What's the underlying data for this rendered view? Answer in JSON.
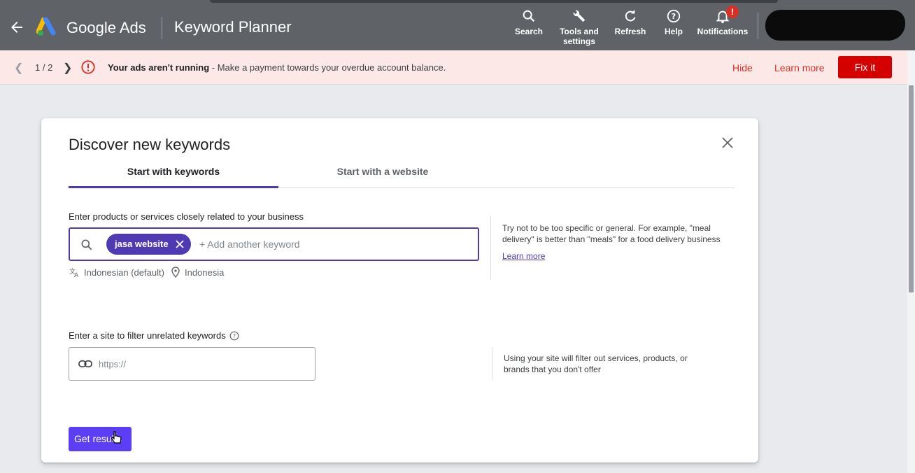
{
  "header": {
    "brand": "Google Ads",
    "page_title": "Keyword Planner",
    "tools": [
      {
        "label": "Search",
        "icon": "search-icon"
      },
      {
        "label": "Tools and settings",
        "icon": "wrench-icon"
      },
      {
        "label": "Refresh",
        "icon": "refresh-icon"
      },
      {
        "label": "Help",
        "icon": "help-icon"
      },
      {
        "label": "Notifications",
        "icon": "bell-icon"
      }
    ],
    "notification_badge": "!"
  },
  "alert": {
    "page": "1 / 2",
    "bold": "Your ads aren't running",
    "message": " - Make a payment towards your overdue account balance.",
    "hide": "Hide",
    "learn_more": "Learn more",
    "fix": "Fix it"
  },
  "dialog": {
    "title": "Discover new keywords",
    "tabs": [
      "Start with keywords",
      "Start with a website"
    ],
    "keywords_label": "Enter products or services closely related to your business",
    "chip": "jasa website",
    "keyword_placeholder": "+ Add another keyword",
    "language": "Indonesian (default)",
    "location": "Indonesia",
    "hint": "Try not to be too specific or general. For example, \"meal delivery\" is better than \"meals\" for a food delivery business",
    "hint_link": "Learn more",
    "site_label": "Enter a site to filter unrelated keywords",
    "site_placeholder": "https://",
    "site_hint": "Using your site will filter out services, products, or brands that you don't offer",
    "submit": "Get results"
  },
  "colors": {
    "header_bg": "#5f6368",
    "alert_bg": "#fce8e6",
    "alert_red": "#d50000",
    "accent": "#4f3ab3",
    "button": "#5c3ef5"
  }
}
